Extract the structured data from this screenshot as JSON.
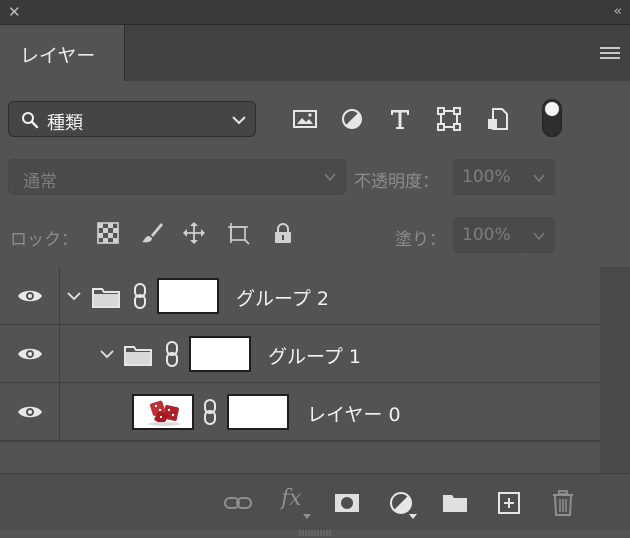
{
  "panel": {
    "tab_label": "レイヤー"
  },
  "filter": {
    "kind_label": "種類"
  },
  "blend_mode": {
    "value": "通常",
    "opacity_label": "不透明度：",
    "opacity_value": "100%"
  },
  "lock": {
    "label": "ロック：",
    "fill_label": "塗り：",
    "fill_value": "100%"
  },
  "layers": [
    {
      "name": "グループ 2",
      "type": "group",
      "indent": 0,
      "visible": true
    },
    {
      "name": "グループ 1",
      "type": "group",
      "indent": 1,
      "visible": true
    },
    {
      "name": "レイヤー 0",
      "type": "pixel",
      "indent": 2,
      "visible": true
    }
  ],
  "footer": {
    "fx_label": "fx"
  },
  "colors": {
    "panel_bg": "#535353",
    "dark_bg": "#323232",
    "text": "#f2f2f2",
    "dim": "#8c8c8c"
  }
}
